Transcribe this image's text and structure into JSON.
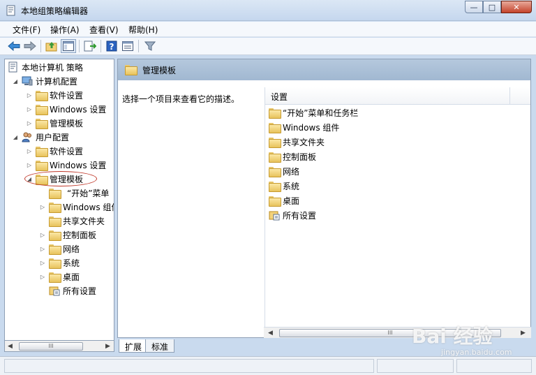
{
  "window": {
    "title": "本地组策略编辑器",
    "buttons": {
      "minimize": "—",
      "maximize": "□",
      "close": "✕"
    }
  },
  "menu": [
    "文件(F)",
    "操作(A)",
    "查看(V)",
    "帮助(H)"
  ],
  "toolbar": {
    "icons": [
      "back-arrow-icon",
      "forward-arrow-icon",
      "up-folder-icon",
      "show-hide-tree-icon",
      "export-list-icon",
      "help-icon",
      "properties-icon",
      "filter-icon"
    ]
  },
  "tree": {
    "root": "本地计算机 策略",
    "computer_config": "计算机配置",
    "user_config": "用户配置",
    "software_settings": "软件设置",
    "windows_settings": "Windows 设置",
    "admin_templates": "管理模板",
    "start_menu": "“开始”菜单",
    "windows_components": "Windows 组件",
    "shared_folders": "共享文件夹",
    "control_panel": "控制面板",
    "network": "网络",
    "system": "系统",
    "desktop": "桌面",
    "all_settings": "所有设置"
  },
  "right": {
    "header_title": "管理模板",
    "description": "选择一个项目来查看它的描述。",
    "column_header": "设置",
    "items": [
      "“开始”菜单和任务栏",
      "Windows 组件",
      "共享文件夹",
      "控制面板",
      "网络",
      "系统",
      "桌面",
      "所有设置"
    ]
  },
  "tabs": [
    "扩展",
    "标准"
  ],
  "scrollbar_grip": "III",
  "watermark": {
    "main": "Bai 经验",
    "sub": "jingyan.baidu.com"
  }
}
